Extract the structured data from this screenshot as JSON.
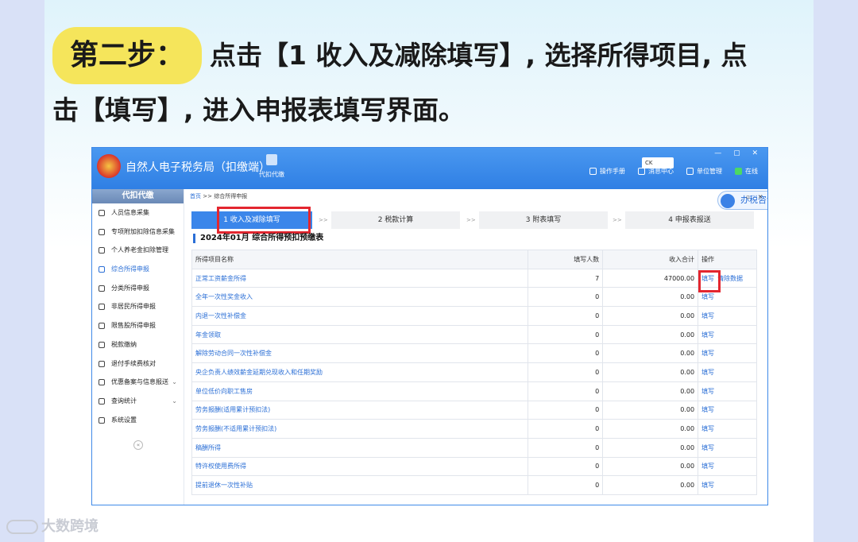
{
  "heading": {
    "step_label": "第二步：",
    "instruction": "点击【1 收入及减除填写】, 选择所得项目, 点击【填写】, 进入申报表填写界面。"
  },
  "window": {
    "app_title": "自然人电子税务局（扣缴端）",
    "proxy_label": "代扣代缴",
    "lang_value": "CK",
    "toolbar": [
      "操作手册",
      "消息中心",
      "单位管理",
      "在线"
    ]
  },
  "sidebar": {
    "header": "代扣代缴",
    "items": [
      {
        "label": "人员信息采集"
      },
      {
        "label": "专项附加扣除信息采集"
      },
      {
        "label": "个人养老金扣除管理"
      },
      {
        "label": "综合所得申报"
      },
      {
        "label": "分类所得申报"
      },
      {
        "label": "非居民所得申报"
      },
      {
        "label": "限售股所得申报"
      },
      {
        "label": "税款缴纳"
      },
      {
        "label": "退付手续费核对"
      },
      {
        "label": "优惠备案与信息报送"
      },
      {
        "label": "查询统计"
      },
      {
        "label": "系统设置"
      }
    ]
  },
  "main": {
    "breadcrumb_home": "首页",
    "breadcrumb_rest": ">> 综合所得申报",
    "consult_label": "办税咨询",
    "steps": [
      "1 收入及减除填写",
      "2 税款计算",
      "3 附表填写",
      "4 申报表报送"
    ],
    "step_sep": ">>",
    "table_title": "2024年01月  综合所得预扣预缴表",
    "columns": [
      "所得项目名称",
      "填写人数",
      "收入合计",
      "操作"
    ],
    "rows": [
      {
        "name": "正常工资薪金所得",
        "count": "7",
        "total": "47000.00",
        "op": "填写",
        "op2": "清除数据"
      },
      {
        "name": "全年一次性奖金收入",
        "count": "0",
        "total": "0.00",
        "op": "填写",
        "op2": ""
      },
      {
        "name": "内退一次性补偿金",
        "count": "0",
        "total": "0.00",
        "op": "填写",
        "op2": ""
      },
      {
        "name": "年金领取",
        "count": "0",
        "total": "0.00",
        "op": "填写",
        "op2": ""
      },
      {
        "name": "解除劳动合同一次性补偿金",
        "count": "0",
        "total": "0.00",
        "op": "填写",
        "op2": ""
      },
      {
        "name": "央企负责人绩效薪金延期兑现收入和任期奖励",
        "count": "0",
        "total": "0.00",
        "op": "填写",
        "op2": ""
      },
      {
        "name": "单位低价向职工售房",
        "count": "0",
        "total": "0.00",
        "op": "填写",
        "op2": ""
      },
      {
        "name": "劳务报酬(适用累计预扣法)",
        "count": "0",
        "total": "0.00",
        "op": "填写",
        "op2": ""
      },
      {
        "name": "劳务报酬(不适用累计预扣法)",
        "count": "0",
        "total": "0.00",
        "op": "填写",
        "op2": ""
      },
      {
        "name": "稿酬所得",
        "count": "0",
        "total": "0.00",
        "op": "填写",
        "op2": ""
      },
      {
        "name": "特许权使用费所得",
        "count": "0",
        "total": "0.00",
        "op": "填写",
        "op2": ""
      },
      {
        "name": "提前退休一次性补贴",
        "count": "0",
        "total": "0.00",
        "op": "填写",
        "op2": ""
      }
    ]
  },
  "watermark": "大数跨境",
  "colors": {
    "accent": "#2b6fd6",
    "highlight": "#e3262f",
    "pill": "#f5e55b"
  }
}
